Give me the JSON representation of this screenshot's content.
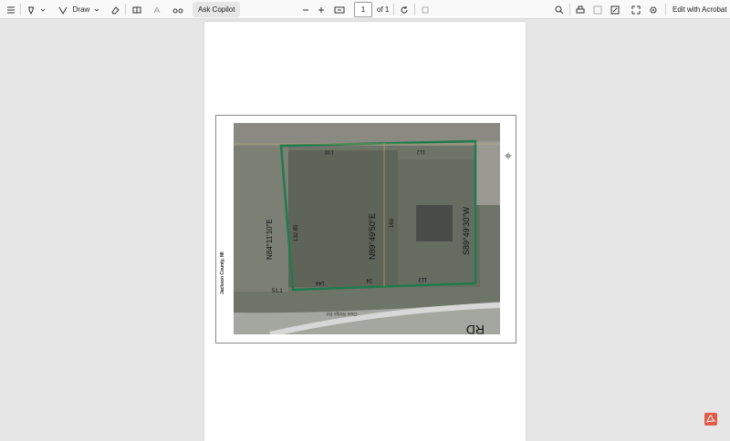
{
  "toolbar": {
    "draw_label": "Draw",
    "ask_copilot_label": "Ask Copilot",
    "page_current": "1",
    "page_of": "of 1",
    "edit_acrobat_label": "Edit with Acrobat"
  },
  "document": {
    "county_label": "Jackson County, MI",
    "map_labels": {
      "road_bottom_right": "RD",
      "road_name": "Deer Ridge Rd",
      "bearing_west": "N84°11'10\"E",
      "bearing_center": "N89°49'50\"E",
      "bearing_east": "S89°49'30\"W",
      "top_left_dim": "130",
      "top_right_dim": "112",
      "bottom_left_dim": "144",
      "bottom_center_dim": "24",
      "bottom_right_dim": "112",
      "left_side_dim": "132.85",
      "mid_dim": "160",
      "lower_left_dim": "51.1"
    }
  },
  "colors": {
    "parcel_outline": "#1f7a4d",
    "page_bg": "#e6e6e6",
    "acrobat_red": "#e25b4b"
  }
}
